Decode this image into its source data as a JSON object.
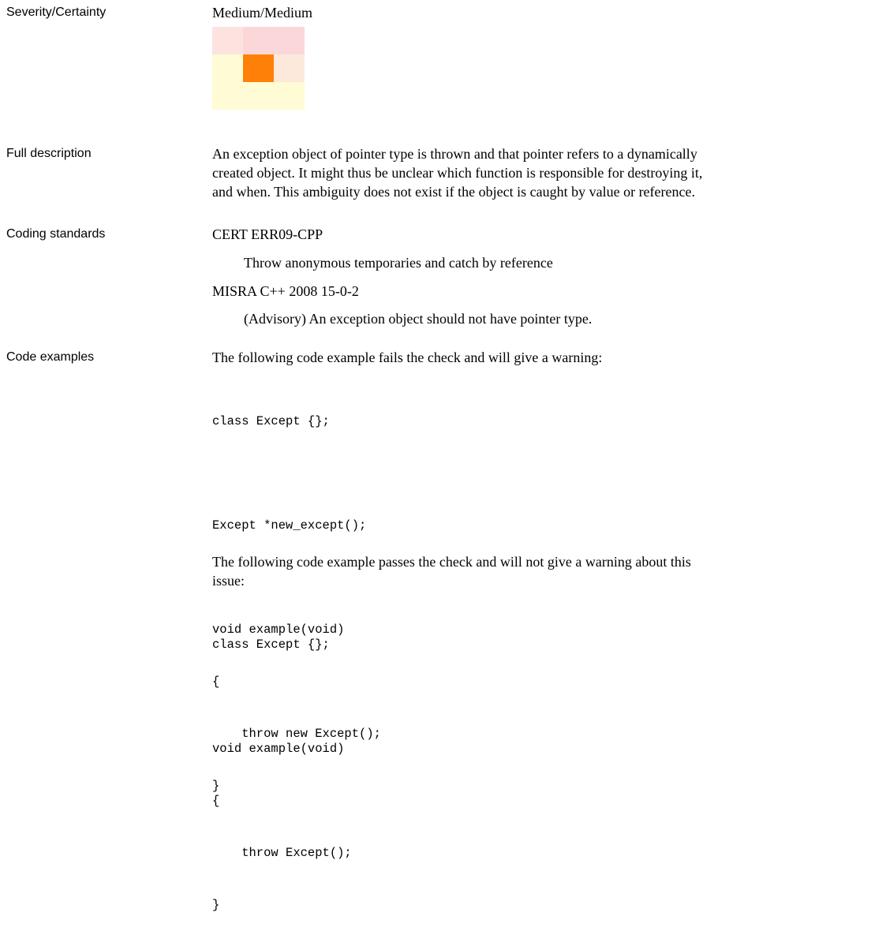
{
  "severity": {
    "label": "Severity/Certainty",
    "value": "Medium/Medium",
    "grid_colors": [
      [
        "#fde3e0",
        "#fcd7d9",
        "#fcd7d9"
      ],
      [
        "#fffbd4",
        "#ff8008",
        "#fde8dc"
      ],
      [
        "#fffbd4",
        "#fffbd4",
        "#fffbd4"
      ]
    ],
    "selected": {
      "row": 1,
      "col": 1
    }
  },
  "full_description": {
    "label": "Full description",
    "lines": [
      "An exception object of pointer type is thrown and that pointer refers to a dynamically",
      "created object. It might thus be unclear which function is responsible for destroying it,",
      "and when. This ambiguity does not exist if the object is caught by value or reference."
    ]
  },
  "coding_standards": {
    "label": "Coding standards",
    "items": [
      {
        "name": "CERT ERR09-CPP",
        "description": "Throw anonymous temporaries and catch by reference"
      },
      {
        "name": "MISRA C++ 2008 15-0-2",
        "description": "(Advisory) An exception object should not have pointer type."
      }
    ]
  },
  "code_examples": {
    "label": "Code examples",
    "fail_intro": "The following code example fails the check and will give a warning:",
    "fail_code": [
      "class Except {};",
      "",
      "Except *new_except();",
      "",
      "void example(void)",
      "{",
      "    throw new Except();",
      "}"
    ],
    "pass_intro_lines": [
      "The following code example passes the check and will not give a warning about this",
      "issue:"
    ],
    "pass_code": [
      "class Except {};",
      "",
      "void example(void)",
      "{",
      "    throw Except();",
      "}"
    ]
  }
}
